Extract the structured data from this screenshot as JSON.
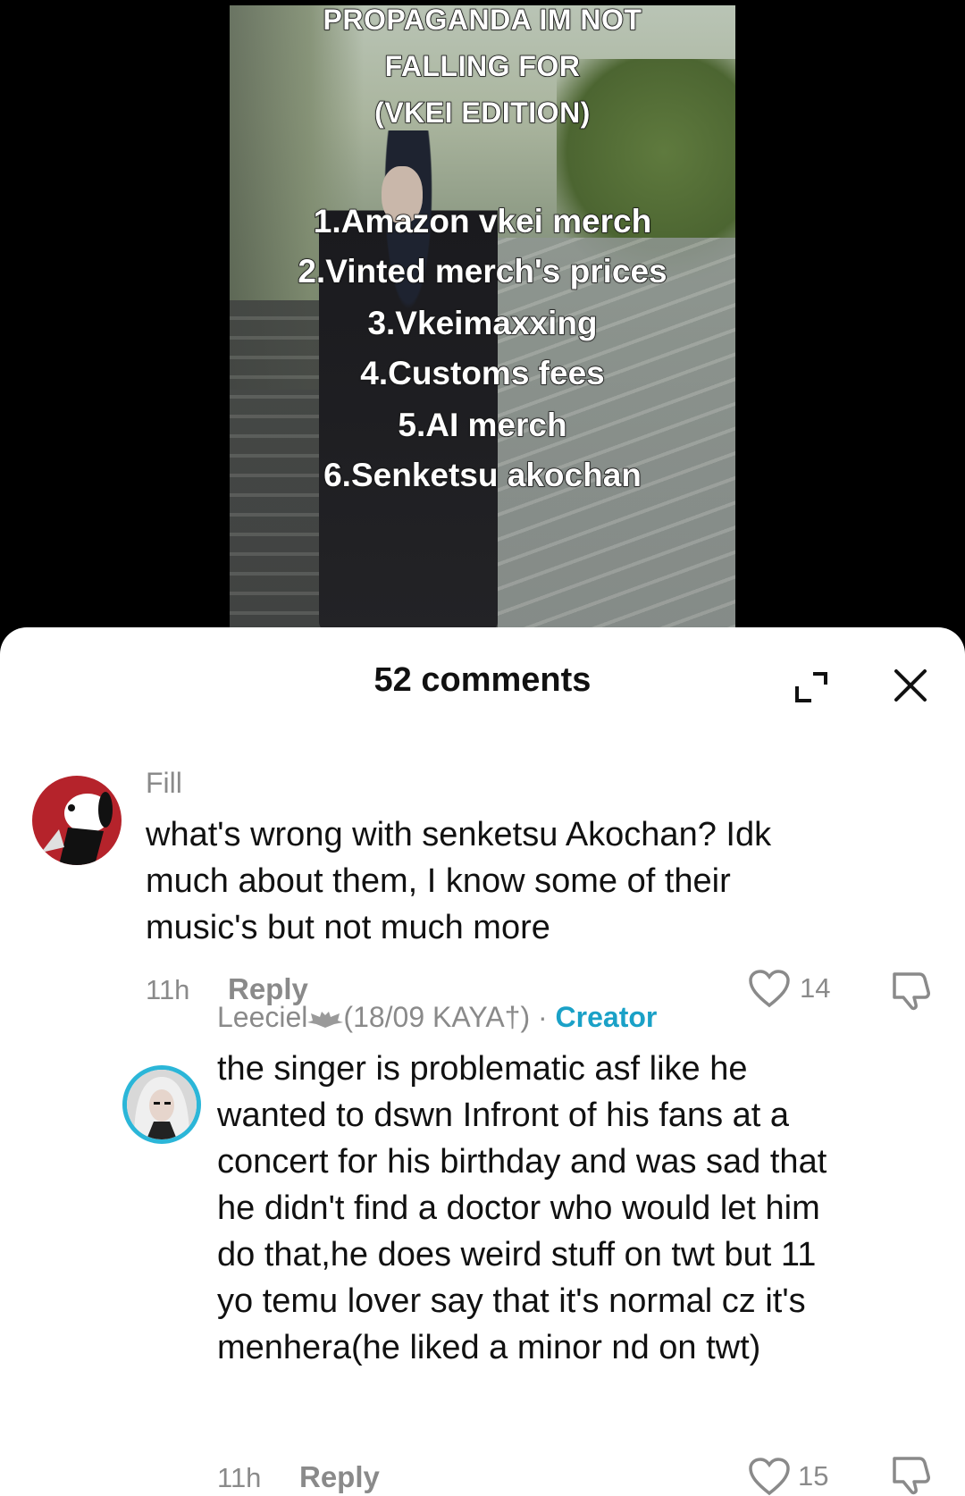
{
  "video": {
    "title_lines": [
      "PROPAGANDA IM NOT",
      "FALLING FOR",
      "(VKEI EDITION)"
    ],
    "list": [
      "1.Amazon vkei merch",
      "2.Vinted merch's prices",
      "3.Vkeimaxxing",
      "4.Customs fees",
      "5.AI merch",
      "6.Senketsu akochan"
    ]
  },
  "sheet": {
    "title": "52 comments",
    "icons": {
      "expand": "expand-icon",
      "close": "close-icon"
    }
  },
  "comments": [
    {
      "username": "Fill",
      "text_lines": [
        "what's wrong with senketsu Akochan? Idk",
        "much about them, I know some of their",
        "music's but not much more"
      ],
      "time": "11h",
      "reply_label": "Reply",
      "likes": "14"
    },
    {
      "username": "Leeciel",
      "username_suffix": "(18/09 KAYA†)",
      "separator": " · ",
      "badge": "Creator",
      "text_lines": [
        "the singer is problematic asf like he",
        "wanted to dswn Infront of his fans at a",
        "concert for his birthday and was sad that",
        "he didn't find a doctor who would let him",
        "do that,he does weird stuff on twt but 11",
        "yo temu lover say that it's normal cz it's",
        "menhera(he liked a minor nd on twt)"
      ],
      "time": "11h",
      "reply_label": "Reply",
      "likes": "15"
    }
  ],
  "colors": {
    "creator_badge": "#1aa1c7",
    "muted": "#8a8a8a",
    "avatar_ring": "#2bb6d8"
  }
}
